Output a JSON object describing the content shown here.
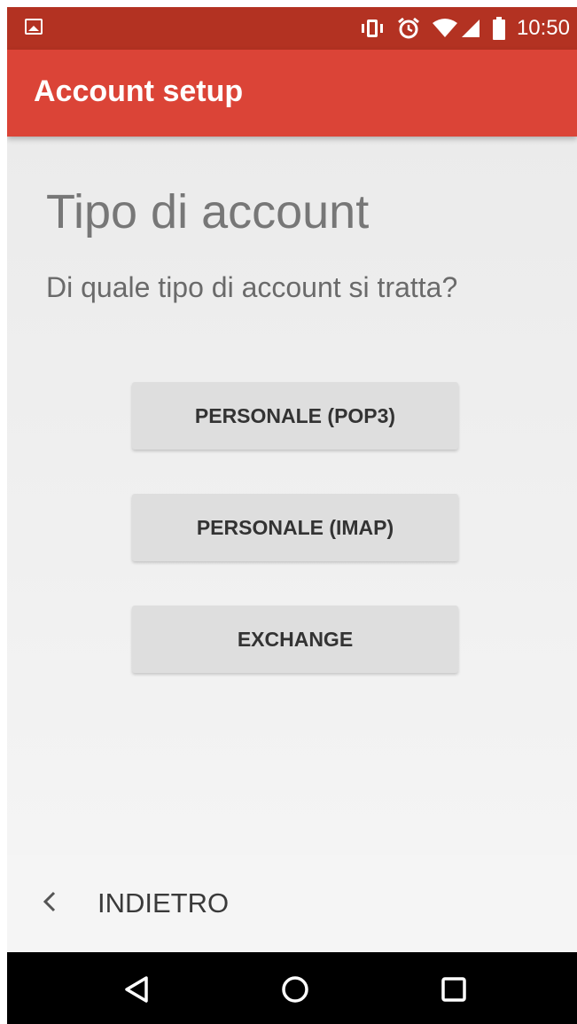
{
  "status_bar": {
    "time": "10:50",
    "icons": [
      "image-notification-icon",
      "vibrate-icon",
      "alarm-icon",
      "wifi-icon",
      "signal-icon",
      "battery-icon"
    ]
  },
  "app_bar": {
    "title": "Account setup",
    "color": "#db4437"
  },
  "main": {
    "title": "Tipo di account",
    "subtitle": "Di quale tipo di account si tratta?",
    "buttons": [
      {
        "label": "PERSONALE (POP3)"
      },
      {
        "label": "PERSONALE (IMAP)"
      },
      {
        "label": "EXCHANGE"
      }
    ]
  },
  "footer": {
    "back_label": "INDIETRO",
    "back_icon": "chevron-left-icon"
  },
  "nav_bar": {
    "icons": [
      "back-triangle-icon",
      "home-circle-icon",
      "recents-square-icon"
    ]
  }
}
